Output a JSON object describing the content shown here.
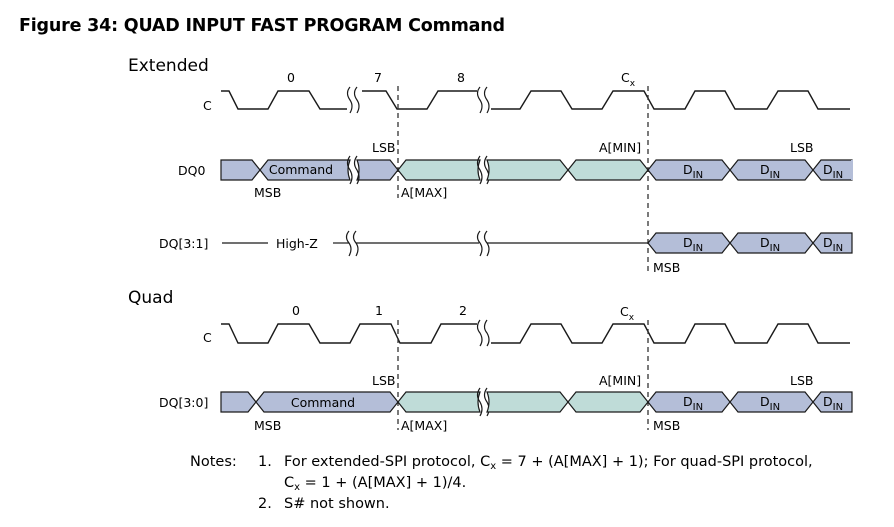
{
  "figure": {
    "title": "Figure 34: QUAD INPUT FAST PROGRAM Command"
  },
  "colors": {
    "command_fill": "#b4bed8",
    "address_fill": "#bfdcd8",
    "data_fill": "#b4bed8",
    "line": "#1a1a1a"
  },
  "extended": {
    "section_label": "Extended",
    "clock": {
      "signal_label": "C",
      "cycle_labels": [
        "0",
        "7",
        "8"
      ],
      "cx_label": "C",
      "cx_sub": "x"
    },
    "dq0": {
      "signal_label": "DQ0",
      "command_label": "Command",
      "msb_label": "MSB",
      "lsb_label": "LSB",
      "amax_label": "A[MAX]",
      "amin_label": "A[MIN]",
      "data_lsb_label": "LSB",
      "data_label": "D",
      "data_sub": "IN"
    },
    "dq31": {
      "signal_label": "DQ[3:1]",
      "highz_label": "High-Z",
      "msb_label": "MSB",
      "data_label": "D",
      "data_sub": "IN"
    }
  },
  "quad": {
    "section_label": "Quad",
    "clock": {
      "signal_label": "C",
      "cycle_labels": [
        "0",
        "1",
        "2"
      ],
      "cx_label": "C",
      "cx_sub": "x"
    },
    "dq30": {
      "signal_label": "DQ[3:0]",
      "command_label": "Command",
      "msb_label": "MSB",
      "lsb_label": "LSB",
      "amax_label": "A[MAX]",
      "amin_label": "A[MIN]",
      "data_msb_label": "MSB",
      "data_lsb_label": "LSB",
      "data_label": "D",
      "data_sub": "IN"
    }
  },
  "notes": {
    "label": "Notes:",
    "items": [
      {
        "num": "1.",
        "line1_pre": "For extended-SPI protocol, C",
        "line1_sub": "x",
        "line1_post": " = 7 + (A[MAX] + 1); For quad-SPI protocol,",
        "line2_pre": "C",
        "line2_sub": "x",
        "line2_post": " = 1 + (A[MAX] + 1)/4."
      },
      {
        "num": "2.",
        "text": "S# not shown."
      }
    ]
  }
}
